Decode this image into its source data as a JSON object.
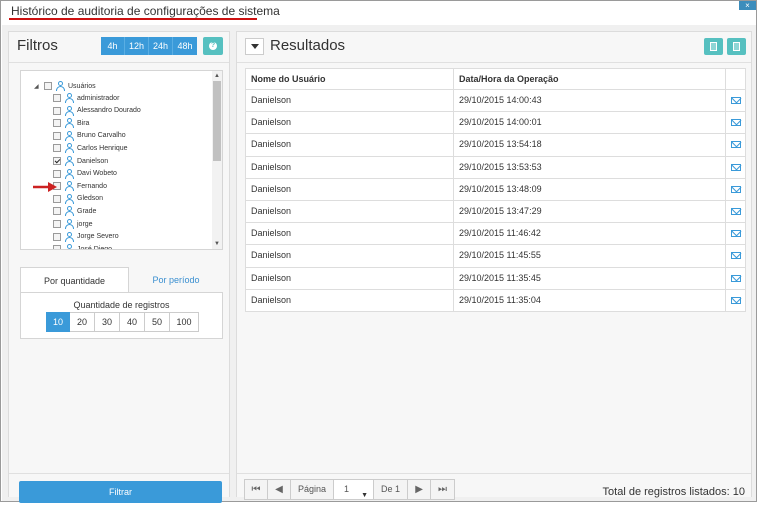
{
  "window": {
    "title": "Histórico de auditoria de configurações de sistema",
    "close_icon": "close-icon"
  },
  "filters": {
    "title": "Filtros",
    "time_buttons": [
      "4h",
      "12h",
      "24h",
      "48h"
    ],
    "help_icon": "question-icon",
    "tree": {
      "root_label": "Usuários",
      "items": [
        {
          "label": "administrador",
          "checked": false
        },
        {
          "label": "Alessandro Dourado",
          "checked": false
        },
        {
          "label": "Bira",
          "checked": false
        },
        {
          "label": "Bruno Carvalho",
          "checked": false
        },
        {
          "label": "Carlos Henrique",
          "checked": false
        },
        {
          "label": "Danielson",
          "checked": true
        },
        {
          "label": "Davi Wobeto",
          "checked": false
        },
        {
          "label": "Fernando",
          "checked": false
        },
        {
          "label": "Gledson",
          "checked": false
        },
        {
          "label": "Grade",
          "checked": false
        },
        {
          "label": "jorge",
          "checked": false
        },
        {
          "label": "Jorge Severo",
          "checked": false
        },
        {
          "label": "José Diego",
          "checked": false
        }
      ]
    },
    "tabs": [
      "Por quantidade",
      "Por período"
    ],
    "quantity_label": "Quantidade de registros",
    "quantity_options": [
      "10",
      "20",
      "30",
      "40",
      "50",
      "100"
    ],
    "quantity_selected": "10",
    "filter_button": "Filtrar"
  },
  "results": {
    "title": "Resultados",
    "columns": [
      "Nome do Usuário",
      "Data/Hora da Operação"
    ],
    "rows": [
      {
        "user": "Danielson",
        "datetime": "29/10/2015 14:00:43"
      },
      {
        "user": "Danielson",
        "datetime": "29/10/2015 14:00:01"
      },
      {
        "user": "Danielson",
        "datetime": "29/10/2015 13:54:18"
      },
      {
        "user": "Danielson",
        "datetime": "29/10/2015 13:53:53"
      },
      {
        "user": "Danielson",
        "datetime": "29/10/2015 13:48:09"
      },
      {
        "user": "Danielson",
        "datetime": "29/10/2015 13:47:29"
      },
      {
        "user": "Danielson",
        "datetime": "29/10/2015 11:46:42"
      },
      {
        "user": "Danielson",
        "datetime": "29/10/2015 11:45:55"
      },
      {
        "user": "Danielson",
        "datetime": "29/10/2015 11:35:45"
      },
      {
        "user": "Danielson",
        "datetime": "29/10/2015 11:35:04"
      }
    ],
    "pager": {
      "page_label": "Página",
      "page_value": "1",
      "of_label": "De 1"
    },
    "total_label": "Total de registros listados: 10"
  },
  "colors": {
    "accent": "#3a9ad9",
    "teal": "#56c0c0",
    "title_underline": "#cc1111"
  }
}
